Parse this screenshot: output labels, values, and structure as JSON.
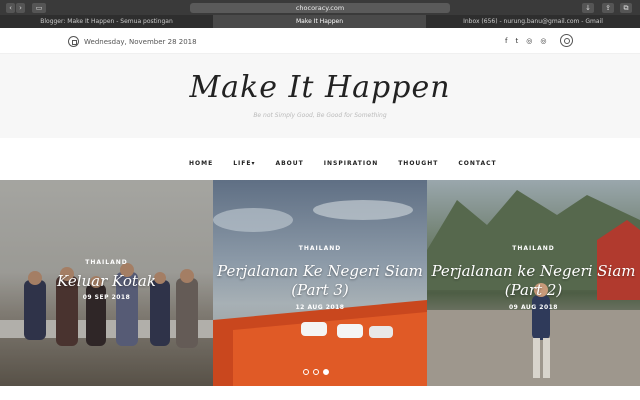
{
  "browser": {
    "url": "chocoracy.com",
    "tabs": [
      {
        "label": "Blogger: Make It Happen - Semua postingan"
      },
      {
        "label": "Make It Happen"
      },
      {
        "label": "Inbox (656) - nurung.banu@gmail.com - Gmail"
      }
    ]
  },
  "topbar": {
    "date": "Wednesday, November 28 2018",
    "social": [
      "f",
      "t",
      "◎",
      "◎"
    ]
  },
  "header": {
    "title": "Make It Happen",
    "tagline": "Be not Simply Good, Be Good for Something"
  },
  "nav": {
    "items": [
      "HOME",
      "LIFE▾",
      "ABOUT",
      "INSPIRATION",
      "THOUGHT",
      "CONTACT"
    ]
  },
  "slides": [
    {
      "category": "THAILAND",
      "title": "Keluar Kotak",
      "date": "09 SEP 2018"
    },
    {
      "category": "THAILAND",
      "title": "Perjalanan Ke Negeri Siam (Part 3)",
      "date": "12 AUG 2018"
    },
    {
      "category": "THAILAND",
      "title": "Perjalanan ke Negeri Siam (Part 2)",
      "date": "09 AUG 2018"
    }
  ],
  "slider": {
    "active_index": 2,
    "count": 3
  }
}
